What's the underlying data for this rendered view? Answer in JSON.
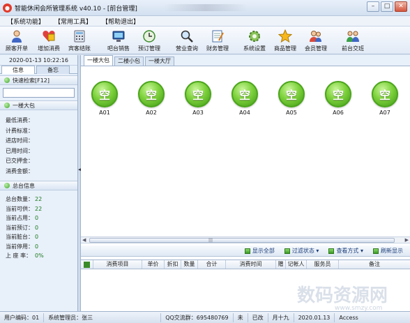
{
  "window": {
    "title": "智能休闲会所管理系统 v40.10 - [前台管理]"
  },
  "menu": [
    "【系统功能】",
    "【常用工具】",
    "【帮助退出】"
  ],
  "toolbar": [
    {
      "label": "顾客开单",
      "icon": "customer-icon"
    },
    {
      "label": "增加消费",
      "icon": "add-consume-icon"
    },
    {
      "label": "宾客结账",
      "icon": "checkout-icon"
    },
    {
      "label": "吧台销售",
      "icon": "bar-sale-icon"
    },
    {
      "label": "预订管理",
      "icon": "reservation-icon"
    },
    {
      "label": "营业查询",
      "icon": "search-icon"
    },
    {
      "label": "财务管理",
      "icon": "finance-icon"
    },
    {
      "label": "系统设置",
      "icon": "gear-icon"
    },
    {
      "label": "商品管理",
      "icon": "star-icon"
    },
    {
      "label": "会员管理",
      "icon": "members-icon"
    },
    {
      "label": "前台交班",
      "icon": "shift-handover-icon"
    }
  ],
  "sidebar": {
    "datetime": "2020-01-13 10:22:16",
    "tabs": [
      "信息",
      "备忘"
    ],
    "quick_search_label": "快速检索[F12]",
    "room_section_label": "一楼大包",
    "fields": [
      "最低消费：",
      "计费标准：",
      "进店时间：",
      "已用时间：",
      "已交押金：",
      "消费金额："
    ],
    "stats_label": "总台信息",
    "stats": [
      {
        "label": "总台数量：",
        "value": "22"
      },
      {
        "label": "当前可供：",
        "value": "22"
      },
      {
        "label": "当前占用：",
        "value": "0"
      },
      {
        "label": "当前预订：",
        "value": "0"
      },
      {
        "label": "当前脏台：",
        "value": "0"
      },
      {
        "label": "当前停用：",
        "value": "0"
      },
      {
        "label": "上 座 率：",
        "value": "0%"
      }
    ]
  },
  "main": {
    "tabs": [
      "一楼大包",
      "二楼小包",
      "一楼大厅"
    ],
    "rooms": [
      {
        "status": "空",
        "name": "A01"
      },
      {
        "status": "空",
        "name": "A02"
      },
      {
        "status": "空",
        "name": "A03"
      },
      {
        "status": "空",
        "name": "A04"
      },
      {
        "status": "空",
        "name": "A05"
      },
      {
        "status": "空",
        "name": "A06"
      },
      {
        "status": "空",
        "name": "A07"
      }
    ],
    "actions": [
      "显示全部",
      "过滤状态 ▾",
      "查看方式 ▾",
      "刷新显示"
    ],
    "columns": [
      "",
      "消费项目",
      "单价",
      "折扣",
      "数量",
      "合计",
      "消费时间",
      "赠",
      "记帐人",
      "服务员",
      "备注"
    ]
  },
  "status": {
    "user": "用户编码：01",
    "admin": "系统管理员：张三",
    "qq": "QQ交流群：695480769",
    "lock": "未",
    "version": "已改",
    "weekday": "月十九",
    "date": "2020.01.13",
    "db": "Access"
  },
  "watermark": "数码资源网",
  "watermark_sub": "www.smzy.com",
  "colors": {
    "room_free": "#5fbf2a",
    "accent": "#1c7a1c"
  }
}
